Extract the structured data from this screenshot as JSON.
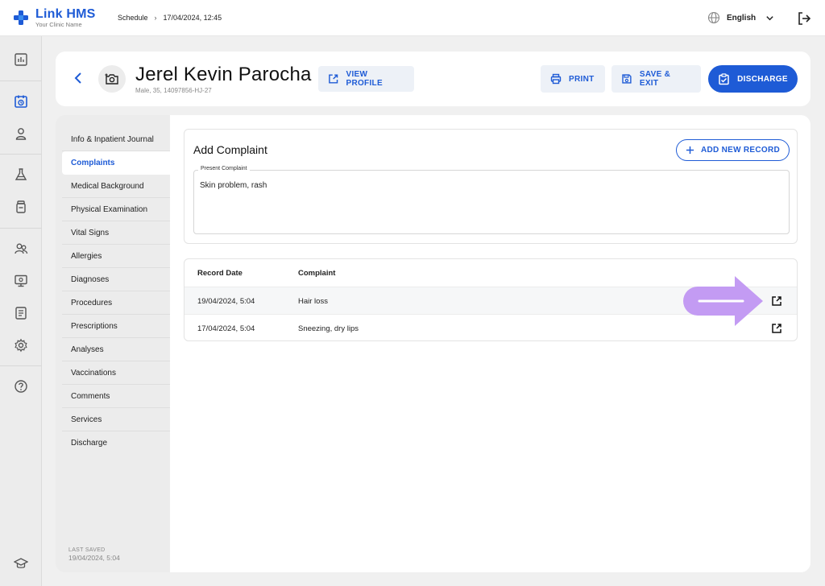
{
  "app": {
    "name": "Link HMS",
    "subtitle": "Your Clinic Name",
    "brand_color": "#1e5bd6"
  },
  "breadcrumb": {
    "section": "Schedule",
    "separator": "›",
    "datetime": "17/04/2024, 12:45"
  },
  "language": {
    "selected": "English",
    "icon": "globe-icon"
  },
  "rail": {
    "icons": [
      "dashboard-icon",
      "schedule-icon",
      "patient-icon",
      "lab-icon",
      "medication-icon",
      "staff-icon",
      "monitor-icon",
      "reports-icon",
      "settings-icon",
      "help-icon",
      "education-icon"
    ]
  },
  "patient": {
    "name": "Jerel Kevin Parocha",
    "meta": "Male, 35, 14097856-HJ-27"
  },
  "actions": {
    "view_profile": "VIEW PROFILE",
    "print": "PRINT",
    "save_exit": "SAVE & EXIT",
    "discharge": "DISCHARGE"
  },
  "sections": [
    "Info & Inpatient Journal",
    "Complaints",
    "Medical Background",
    "Physical Examination",
    "Vital Signs",
    "Allergies",
    "Diagnoses",
    "Procedures",
    "Prescriptions",
    "Analyses",
    "Vaccinations",
    "Comments",
    "Services",
    "Discharge"
  ],
  "active_section": "Complaints",
  "last_saved": {
    "label": "LAST SAVED",
    "value": "19/04/2024, 5:04"
  },
  "complaint_form": {
    "title": "Add Complaint",
    "add_button": "ADD NEW RECORD",
    "field_label": "Present Complaint",
    "field_value": "Skin problem, rash"
  },
  "records": {
    "columns": [
      "Record Date",
      "Complaint"
    ],
    "rows": [
      {
        "date": "19/04/2024, 5:04",
        "complaint": "Hair loss"
      },
      {
        "date": "17/04/2024, 5:04",
        "complaint": "Sneezing, dry lips"
      }
    ]
  },
  "pointer": {
    "color": "#c39bf3"
  }
}
